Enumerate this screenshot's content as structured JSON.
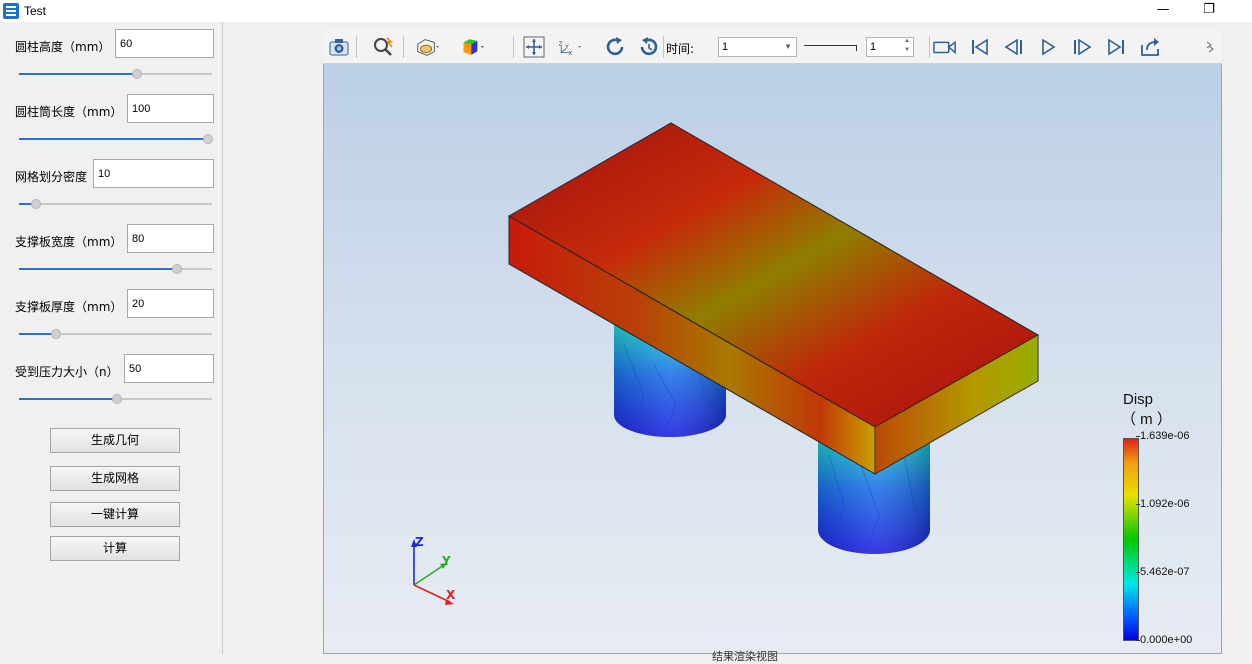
{
  "window": {
    "title": "Test",
    "minimize_glyph": "—",
    "maximize_glyph": "❐"
  },
  "params": [
    {
      "label": "圆柱高度（mm）",
      "value": "60",
      "slider_fraction": 0.61
    },
    {
      "label": "圆柱筒长度（mm）",
      "value": "100",
      "slider_fraction": 0.98
    },
    {
      "label": "网格划分密度",
      "value": "10",
      "slider_fraction": 0.09
    },
    {
      "label": "支撑板宽度（mm）",
      "value": "80",
      "slider_fraction": 0.82
    },
    {
      "label": "支撑板厚度（mm）",
      "value": "20",
      "slider_fraction": 0.19
    },
    {
      "label": "受到压力大小（n）",
      "value": "50",
      "slider_fraction": 0.51
    }
  ],
  "buttons": {
    "generate_geometry": "生成几何",
    "generate_mesh": "生成网格",
    "one_click_compute": "一键计算",
    "compute": "计算"
  },
  "toolbar": {
    "time_label": "时间:",
    "time_value": "1",
    "step_value": "1",
    "icons": [
      "camera-icon",
      "zoom-fit-icon",
      "view-style-icon",
      "color-cube-icon",
      "pan-icon",
      "axes-orient-icon",
      "rotate-icon",
      "reset-view-icon",
      "record-icon",
      "first-frame-icon",
      "prev-frame-icon",
      "play-icon",
      "next-frame-icon",
      "last-frame-icon",
      "export-icon"
    ]
  },
  "legend": {
    "title": "Disp",
    "unit": "（ m ）",
    "ticks": [
      "1.639e-06",
      "1.092e-06",
      "5.462e-07",
      "0.000e+00"
    ],
    "colors": [
      "#e0211b",
      "#e8e000",
      "#00c800",
      "#00e8e8",
      "#0000e0"
    ]
  },
  "axes": {
    "x": "X",
    "y": "Y",
    "z": "Z"
  },
  "footer_partial": "结果渲染视图"
}
